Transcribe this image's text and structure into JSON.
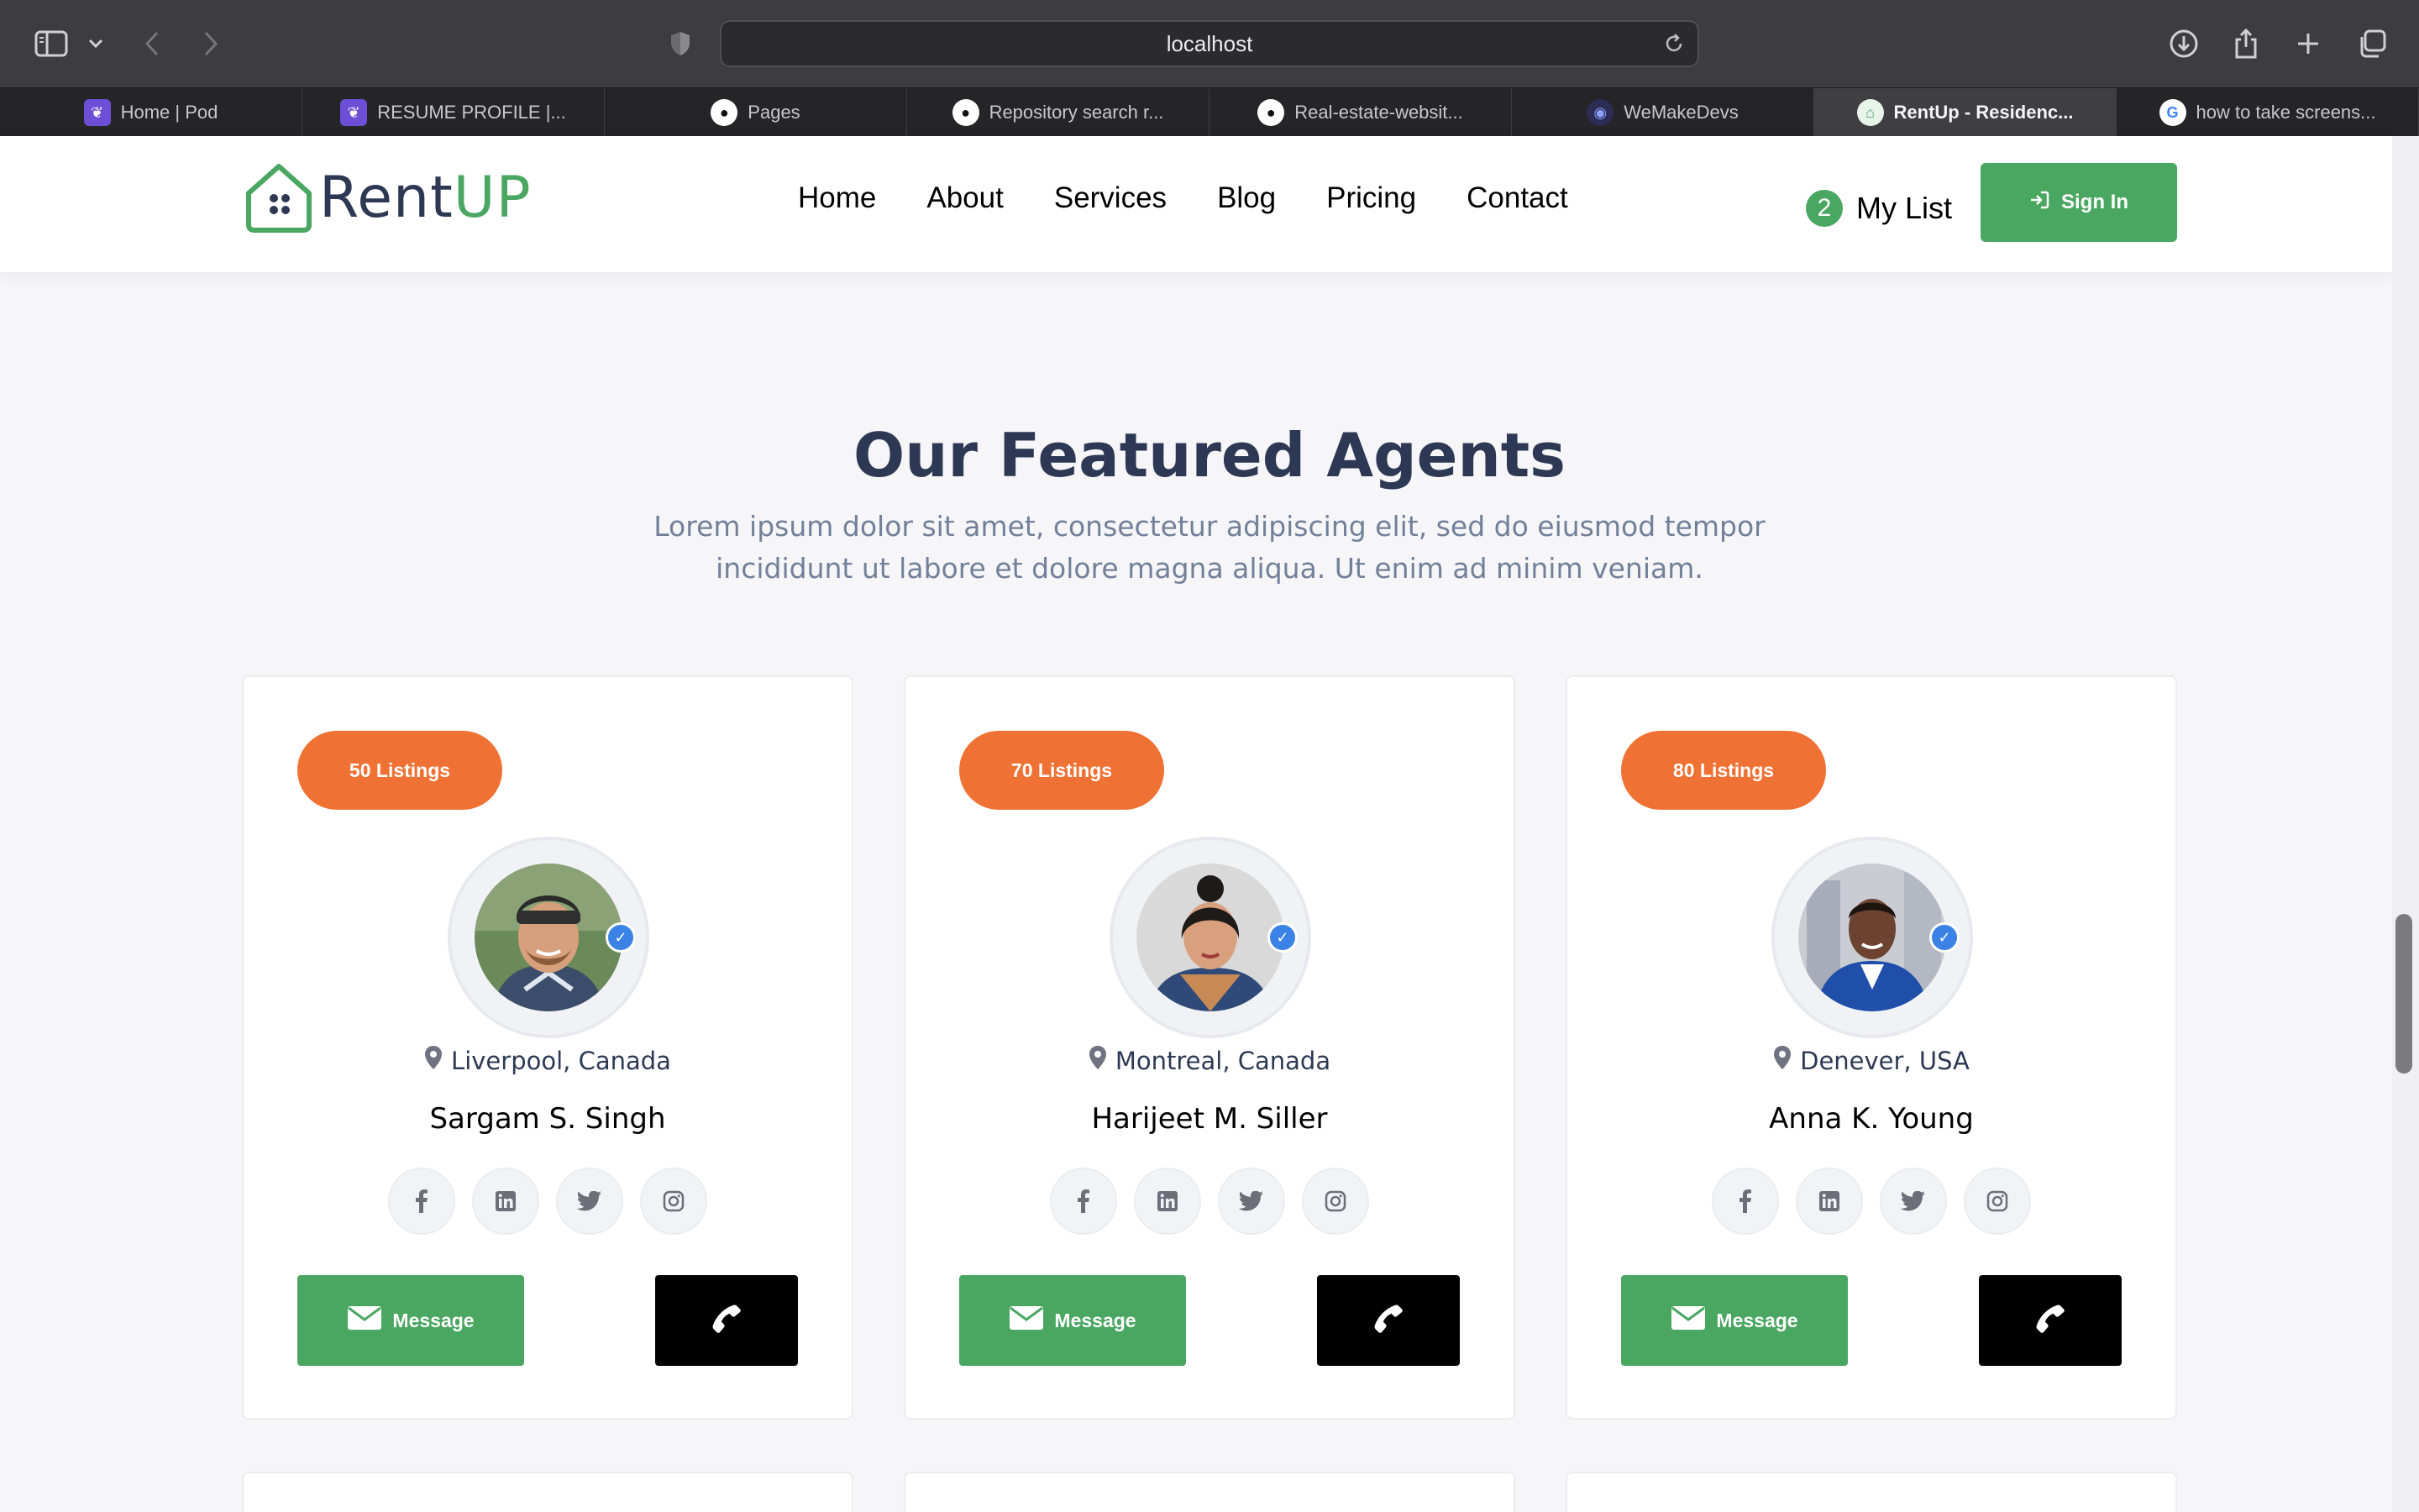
{
  "browser": {
    "url": "localhost",
    "tabs": [
      {
        "label": "Home | Pod",
        "favicon": "pod-icon",
        "active": false
      },
      {
        "label": "RESUME PROFILE |...",
        "favicon": "pod-icon",
        "active": false
      },
      {
        "label": "Pages",
        "favicon": "github-icon",
        "active": false
      },
      {
        "label": "Repository search r...",
        "favicon": "github-icon",
        "active": false
      },
      {
        "label": "Real-estate-websit...",
        "favicon": "github-icon",
        "active": false
      },
      {
        "label": "WeMakeDevs",
        "favicon": "wemakedevs-icon",
        "active": false
      },
      {
        "label": "RentUp - Residenc...",
        "favicon": "rentup-icon",
        "active": true
      },
      {
        "label": "how to take screens...",
        "favicon": "google-icon",
        "active": false
      }
    ]
  },
  "header": {
    "logo": {
      "part1": "Rent",
      "part2": "UP"
    },
    "nav": [
      "Home",
      "About",
      "Services",
      "Blog",
      "Pricing",
      "Contact"
    ],
    "mylist": {
      "count": "2",
      "label": "My List"
    },
    "signin_label": "Sign In"
  },
  "section": {
    "title": "Our Featured Agents",
    "subtitle": "Lorem ipsum dolor sit amet, consectetur adipiscing elit, sed do eiusmod tempor incididunt ut labore et dolore magna aliqua. Ut enim ad minim veniam."
  },
  "agents": [
    {
      "listings": "50 Listings",
      "location": "Liverpool, Canada",
      "name": "Sargam S. Singh",
      "message_label": "Message"
    },
    {
      "listings": "70 Listings",
      "location": "Montreal, Canada",
      "name": "Harijeet M. Siller",
      "message_label": "Message"
    },
    {
      "listings": "80 Listings",
      "location": "Denever, USA",
      "name": "Anna K. Young",
      "message_label": "Message"
    }
  ],
  "colors": {
    "brand_green": "#4aa761",
    "listing_orange": "#f07134",
    "heading_navy": "#2d3954",
    "verified_blue": "#3b82e6"
  }
}
